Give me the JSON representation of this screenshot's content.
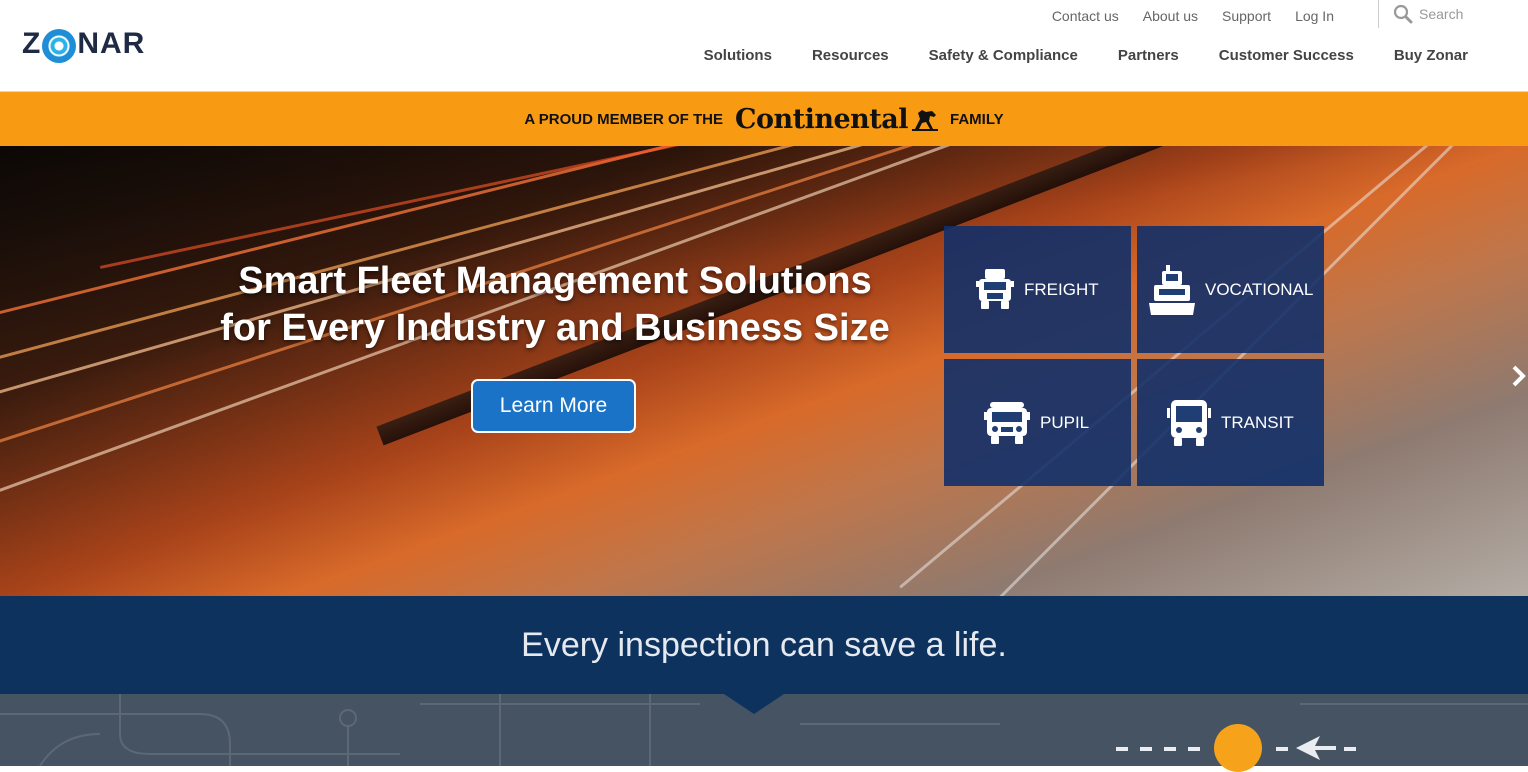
{
  "header": {
    "logo_text_left": "Z",
    "logo_text_right": "NAR",
    "utility_links": [
      "Contact us",
      "About us",
      "Support",
      "Log In"
    ],
    "search_placeholder": "Search",
    "nav": [
      "Solutions",
      "Resources",
      "Safety & Compliance",
      "Partners",
      "Customer Success",
      "Buy Zonar"
    ]
  },
  "banner": {
    "prefix": "A PROUD MEMBER OF THE",
    "brand": "Continental",
    "suffix": "FAMILY",
    "color": "#f99b12"
  },
  "hero": {
    "title_line1": "Smart Fleet Management Solutions",
    "title_line2": "for Every Industry and Business Size",
    "cta": "Learn More",
    "tiles": [
      {
        "label": "FREIGHT",
        "icon": "truck-icon"
      },
      {
        "label": "VOCATIONAL",
        "icon": "plow-truck-icon"
      },
      {
        "label": "PUPIL",
        "icon": "school-bus-icon"
      },
      {
        "label": "TRANSIT",
        "icon": "bus-icon"
      }
    ]
  },
  "tagline": "Every inspection can save a life.",
  "colors": {
    "navy": "#0d325e",
    "tile": "#123069",
    "cta": "#1a73c7",
    "accent": "#f99b12"
  }
}
